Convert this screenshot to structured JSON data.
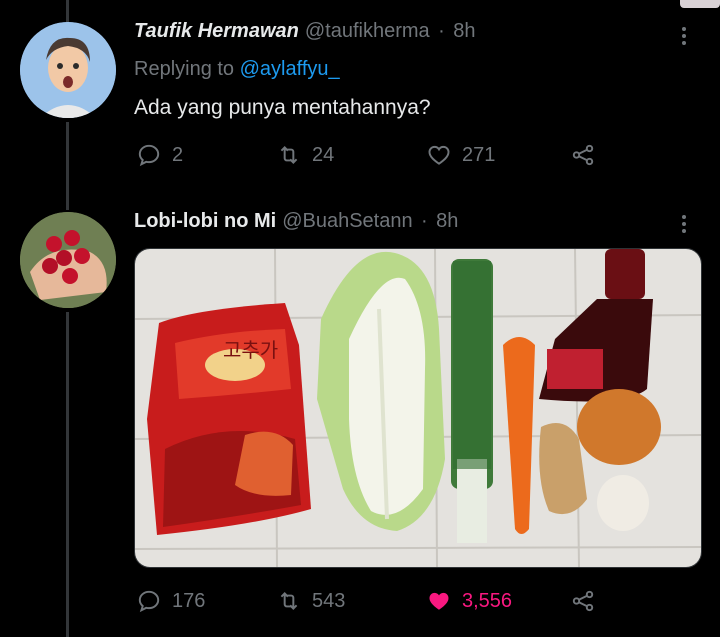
{
  "tweet1": {
    "name": "Taufik Hermawan",
    "handle": "@taufikherma",
    "dot": "·",
    "time": "8h",
    "replying_prefix": "Replying to",
    "replying_to": "@aylaffyu_",
    "text": "Ada yang punya mentahannya?",
    "stats": {
      "replies": "2",
      "retweets": "24",
      "likes": "271"
    },
    "icons": {
      "reply": "reply-icon",
      "retweet": "retweet-icon",
      "like": "heart-icon",
      "share": "share-icon",
      "more": "more-dots-icon"
    }
  },
  "tweet2": {
    "name": "Lobi-lobi no Mi",
    "handle": "@BuahSetann",
    "dot": "·",
    "time": "8h",
    "stats": {
      "replies": "176",
      "retweets": "543",
      "likes": "3,556"
    },
    "liked": true,
    "icons": {
      "reply": "reply-icon",
      "retweet": "retweet-icon",
      "like": "heart-filled-icon",
      "share": "share-icon",
      "more": "more-dots-icon"
    },
    "media_label_korean": "고추가"
  },
  "colors": {
    "background": "#000000",
    "secondary": "#71767b",
    "link": "#1d9bf0",
    "like": "#f91880"
  }
}
